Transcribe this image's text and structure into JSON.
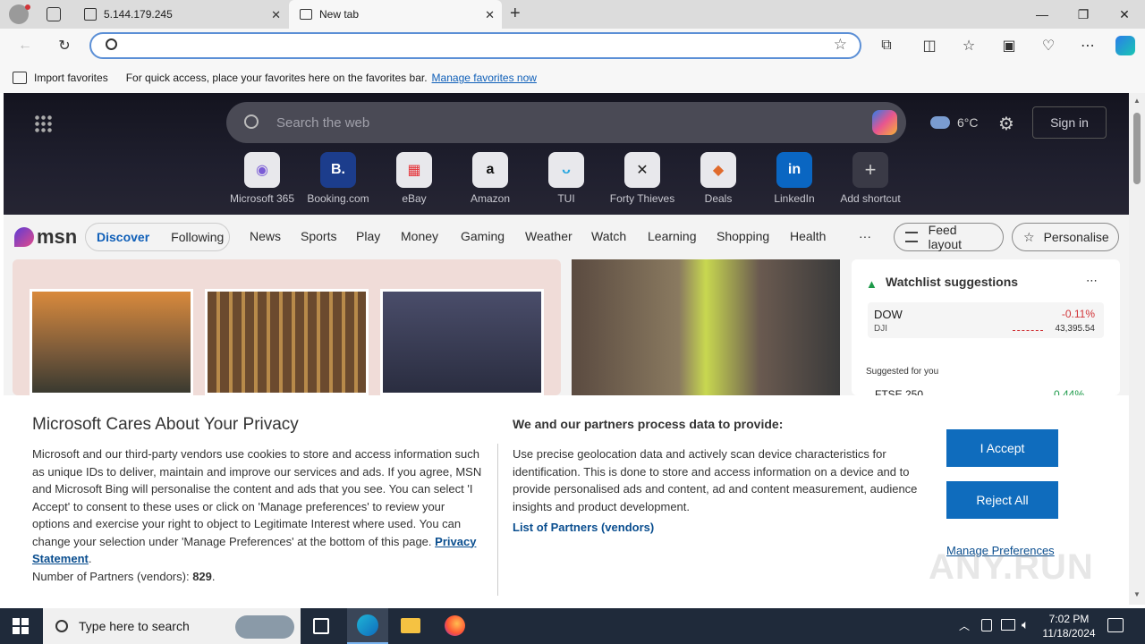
{
  "browser": {
    "tabs": [
      {
        "title": "5.144.179.245"
      },
      {
        "title": "New tab"
      }
    ],
    "address_value": "",
    "favorites_bar": {
      "import_label": "Import favorites",
      "hint": "For quick access, place your favorites here on the favorites bar.",
      "manage_link": "Manage favorites now"
    }
  },
  "newtab": {
    "search_placeholder": "Search the web",
    "weather_temp": "6°C",
    "sign_in": "Sign in",
    "shortcuts": [
      {
        "label": "Microsoft 365",
        "icon": "ms365-icon"
      },
      {
        "label": "Booking.com",
        "icon": "booking-icon"
      },
      {
        "label": "eBay",
        "icon": "ebay-icon"
      },
      {
        "label": "Amazon",
        "icon": "amazon-icon"
      },
      {
        "label": "TUI",
        "icon": "tui-icon"
      },
      {
        "label": "Forty Thieves",
        "icon": "forty-thieves-icon"
      },
      {
        "label": "Deals",
        "icon": "deals-icon"
      },
      {
        "label": "LinkedIn",
        "icon": "linkedin-icon"
      },
      {
        "label": "Add shortcut",
        "icon": "plus-icon"
      }
    ],
    "msn_logo": "msn",
    "nav_toggle": [
      "Discover",
      "Following"
    ],
    "nav": [
      "News",
      "Sports",
      "Play",
      "Money",
      "Gaming",
      "Weather",
      "Watch",
      "Learning",
      "Shopping",
      "Health"
    ],
    "more": "···",
    "feed_layout": "Feed layout",
    "personalise": "Personalise",
    "watchlist": {
      "title": "Watchlist suggestions",
      "items": [
        {
          "name": "DOW",
          "sub": "DJI",
          "change": "-0.11%",
          "value": "43,395.54"
        }
      ],
      "suggested": "Suggested for you",
      "partial_item": "FTSE 250",
      "partial_change": "0.44%"
    }
  },
  "privacy": {
    "title": "Microsoft Cares About Your Privacy",
    "body": "Microsoft and our third-party vendors use cookies to store and access information such as unique IDs to deliver, maintain and improve our services and ads. If you agree, MSN and Microsoft Bing will personalise the content and ads that you see. You can select 'I Accept' to consent to these uses or click on 'Manage preferences' to review your options and exercise your right to object to Legitimate Interest where used.  You can change your selection under 'Manage Preferences' at the bottom of this page.",
    "privacy_link": "Privacy Statement",
    "partners_label": "Number of Partners (vendors):",
    "partners_count": "829",
    "purposes_title": "We and our partners process data to provide:",
    "purposes_body": "Use precise geolocation data and actively scan device characteristics for identification. This is done to store and access information on a device and to provide personalised ads and content, ad and content measurement, audience insights and product development.",
    "list_partners": "List of Partners (vendors)",
    "accept": "I Accept",
    "reject": "Reject All",
    "manage": "Manage Preferences"
  },
  "taskbar": {
    "search_placeholder": "Type here to search",
    "time": "7:02 PM",
    "date": "11/18/2024"
  },
  "watermark": "ANY.RUN"
}
